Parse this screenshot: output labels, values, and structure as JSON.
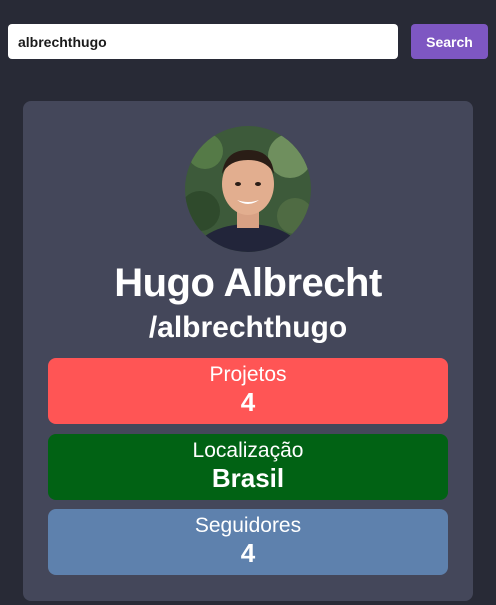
{
  "search": {
    "value": "albrechthugo",
    "button_label": "Search"
  },
  "profile": {
    "name": "Hugo Albrecht",
    "username": "/albrechthugo",
    "stats": {
      "projects": {
        "label": "Projetos",
        "value": "4",
        "color": "#ff5555"
      },
      "location": {
        "label": "Localização",
        "value": "Brasil",
        "color": "#016214"
      },
      "followers": {
        "label": "Seguidores",
        "value": "4",
        "color": "#5e81ad"
      }
    }
  },
  "colors": {
    "page_background": "#282a36",
    "card_background": "#44475a",
    "accent": "#7e57c2"
  }
}
